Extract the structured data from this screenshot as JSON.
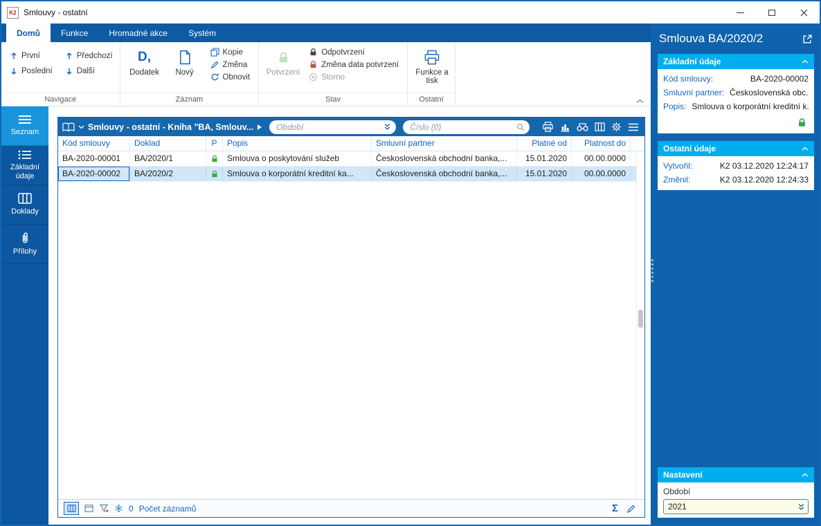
{
  "colors": {
    "accent_blue": "#1565c0",
    "ribbon_bar_blue": "#0e5aa5",
    "sidebar_blue": "#0d57a0",
    "sidebar_active_blue": "#1895dc",
    "toolbar_blue": "#1568ae",
    "panel_blue": "#0f63ac",
    "section_cyan": "#00aeef",
    "selection_row": "#cfe7f8",
    "lock_green": "#3aaa44",
    "lock_green_pale": "#bfe0c3",
    "lock_dark": "#4a4a4a",
    "lock_red": "#c0504d"
  },
  "icons": {
    "sum": "Σ",
    "dodatek_glyph": "D,"
  },
  "titlebar": {
    "app_badge": "K2",
    "title": "Smlouvy - ostatní"
  },
  "ribbon": {
    "tabs": [
      {
        "label": "Domů"
      },
      {
        "label": "Funkce"
      },
      {
        "label": "Hromadné akce"
      },
      {
        "label": "Systém"
      }
    ],
    "navigace": {
      "label": "Navigace",
      "prvni": "První",
      "posledni": "Poslední",
      "predchozi": "Předchozí",
      "dalsi": "Další"
    },
    "zaznam": {
      "label": "Záznam",
      "dodatek": "Dodatek",
      "novy": "Nový",
      "kopie": "Kopie",
      "zmena": "Změna",
      "obnovit": "Obnovit"
    },
    "stav": {
      "label": "Stav",
      "potvrzeni": "Potvrzení",
      "odpotvrzeni": "Odpotvrzení",
      "zmena_data": "Změna data potvrzení",
      "storno": "Storno"
    },
    "ostatni": {
      "label": "Ostatní",
      "funkce_a_tisk": "Funkce a tisk"
    }
  },
  "sidebar": {
    "items": [
      {
        "label": "Seznam"
      },
      {
        "label": "Základní údaje"
      },
      {
        "label": "Doklady"
      },
      {
        "label": "Přílohy"
      }
    ]
  },
  "browser": {
    "title": "Smlouvy - ostatní - Kniha \"BA, Smlouv...",
    "obdobi_placeholder": "Období",
    "cislo_placeholder": "Číslo (0)",
    "columns": [
      "Kód smlouvy",
      "Doklad",
      "P",
      "Popis",
      "Smluvní partner",
      "Platné od",
      "Platnost do"
    ],
    "rows": [
      {
        "kod": "BA-2020-00001",
        "doklad": "BA/2020/1",
        "popis": "Smlouva o poskytování služeb",
        "partner": "Československá obchodní banka,...",
        "od": "15.01.2020",
        "do": "00.00.0000"
      },
      {
        "kod": "BA-2020-00002",
        "doklad": "BA/2020/2",
        "popis": "Smlouva o korporátní kreditní ka...",
        "partner": "Československá obchodní banka,...",
        "od": "15.01.2020",
        "do": "00.00.0000"
      }
    ],
    "status": {
      "frozen_count": "0",
      "count_label": "Počet záznamů"
    }
  },
  "detail": {
    "title": "Smlouva BA/2020/2",
    "zakladni": {
      "title": "Základní údaje",
      "fields": [
        {
          "label": "Kód smlouvy:",
          "value": "BA-2020-00002"
        },
        {
          "label": "Smluvní partner:",
          "value": "Československá obc..."
        },
        {
          "label": "Popis:",
          "value": "Smlouva o korporátní kreditní k..."
        }
      ]
    },
    "ostatni": {
      "title": "Ostatní údaje",
      "fields": [
        {
          "label": "Vytvořil:",
          "value": "K2 03.12.2020 12:24:17"
        },
        {
          "label": "Změnil:",
          "value": "K2 03.12.2020 12:24:33"
        }
      ]
    },
    "nastaveni": {
      "title": "Nastavení",
      "obdobi_label": "Období",
      "obdobi_value": "2021"
    }
  }
}
